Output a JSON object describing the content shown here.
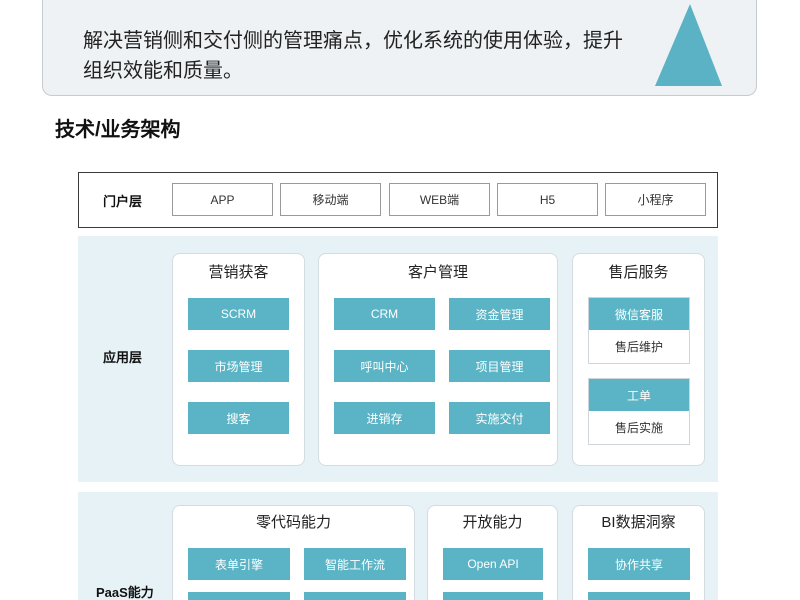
{
  "intro": {
    "text": "解决营销侧和交付侧的管理痛点，优化系统的使用体验，提升组织效能和质量。"
  },
  "section_title": "技术/业务架构",
  "architecture": {
    "portal": {
      "label": "门户层",
      "items": [
        "APP",
        "移动端",
        "WEB端",
        "H5",
        "小程序"
      ]
    },
    "application": {
      "label": "应用层",
      "groups": [
        {
          "title": "营销获客",
          "items": [
            "SCRM",
            "市场管理",
            "搜客"
          ]
        },
        {
          "title": "客户管理",
          "items": [
            "CRM",
            "资金管理",
            "呼叫中心",
            "项目管理",
            "进销存",
            "实施交付"
          ]
        },
        {
          "title": "售后服务",
          "subgroups": [
            {
              "head": "微信客服",
              "sub": "售后维护"
            },
            {
              "head": "工单",
              "sub": "售后实施"
            }
          ]
        }
      ]
    },
    "paas": {
      "label": "PaaS能力",
      "groups": [
        {
          "title": "零代码能力",
          "items": [
            "表单引擎",
            "智能工作流"
          ]
        },
        {
          "title": "开放能力",
          "items": [
            "Open API"
          ]
        },
        {
          "title": "BI数据洞察",
          "items": [
            "协作共享"
          ]
        }
      ]
    }
  },
  "decoration": {
    "corner_icon": "triangle-shape"
  },
  "colors": {
    "accent": "#5ab4c5",
    "layer_bg": "#e6f2f6",
    "intro_bg": "#eef2f5",
    "text": "#222222"
  }
}
